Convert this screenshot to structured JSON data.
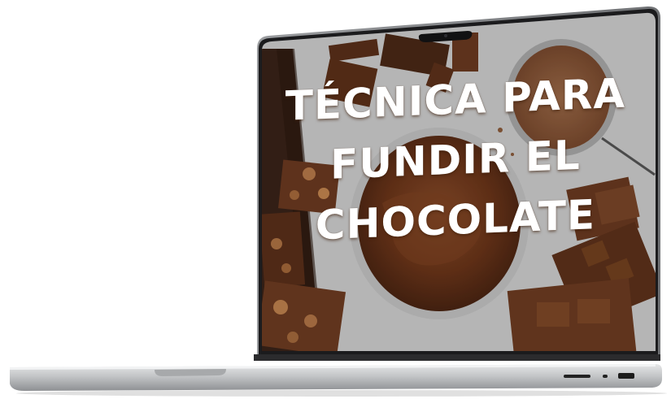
{
  "screen": {
    "title_lines": [
      "TÉCNICA PARA",
      "FUNDIR EL",
      "CHOCOLATE"
    ]
  },
  "colors": {
    "chocolate_dark": "#4a2816",
    "chocolate_mid": "#7a4526",
    "chocolate_light": "#9a5a36",
    "board": "#3a2318",
    "table_gray": "#cfcfcf",
    "cocoa_powder": "#8b5a3a",
    "laptop_silver": "#c9cbcd",
    "bezel": "#1b1b1d"
  },
  "icons": {
    "camera": "camera-notch-icon",
    "ports": "side-ports-icon"
  }
}
